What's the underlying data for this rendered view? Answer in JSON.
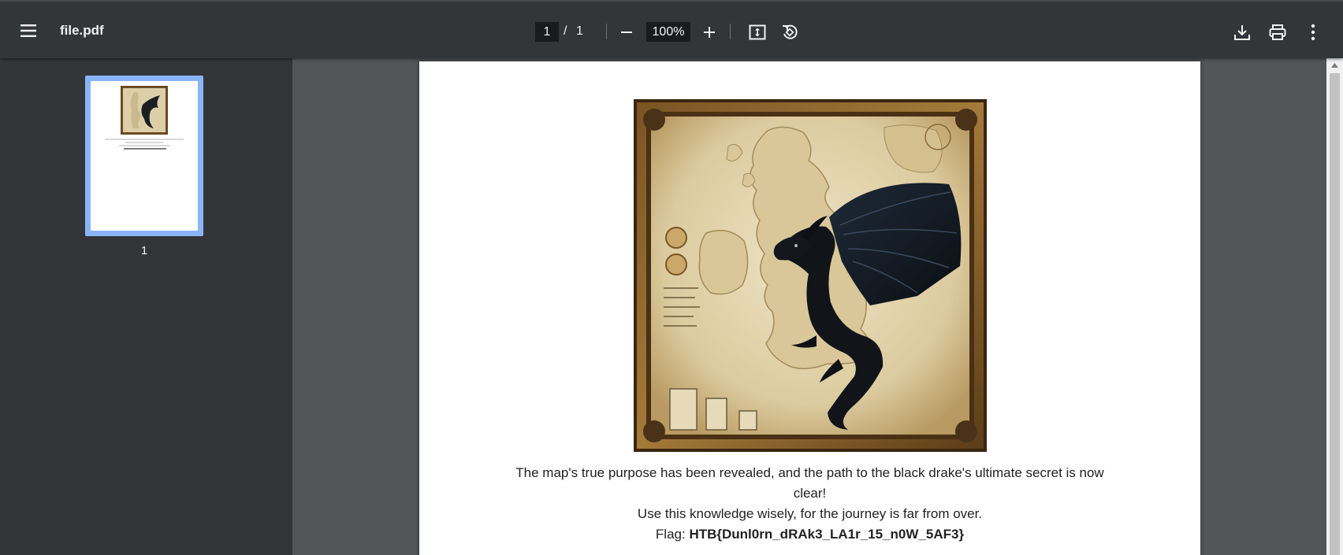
{
  "toolbar": {
    "file_name": "file.pdf",
    "current_page": "1",
    "page_separator": "/",
    "total_pages": "1",
    "zoom": "100%",
    "icons": [
      "menu-icon",
      "zoom-out-icon",
      "zoom-in-icon",
      "fit-page-icon",
      "rotate-icon",
      "download-icon",
      "print-icon",
      "more-vert-icon"
    ]
  },
  "sidebar": {
    "thumbnails": [
      {
        "page_number": "1"
      }
    ]
  },
  "document": {
    "caption_line_1": "The map's true purpose has been revealed, and the path to the black drake's ultimate secret is now clear!",
    "caption_line_2": "Use this knowledge wisely, for the journey is far from over.",
    "flag_label": "Flag: ",
    "flag_value": "HTB{Dunl0rn_dRAk3_LA1r_15_n0W_5AF3}"
  },
  "colors": {
    "toolbar_bg": "#323639",
    "viewer_bg": "#525659",
    "thumbnail_highlight": "#8ab4f8",
    "page_bg": "#ffffff"
  }
}
